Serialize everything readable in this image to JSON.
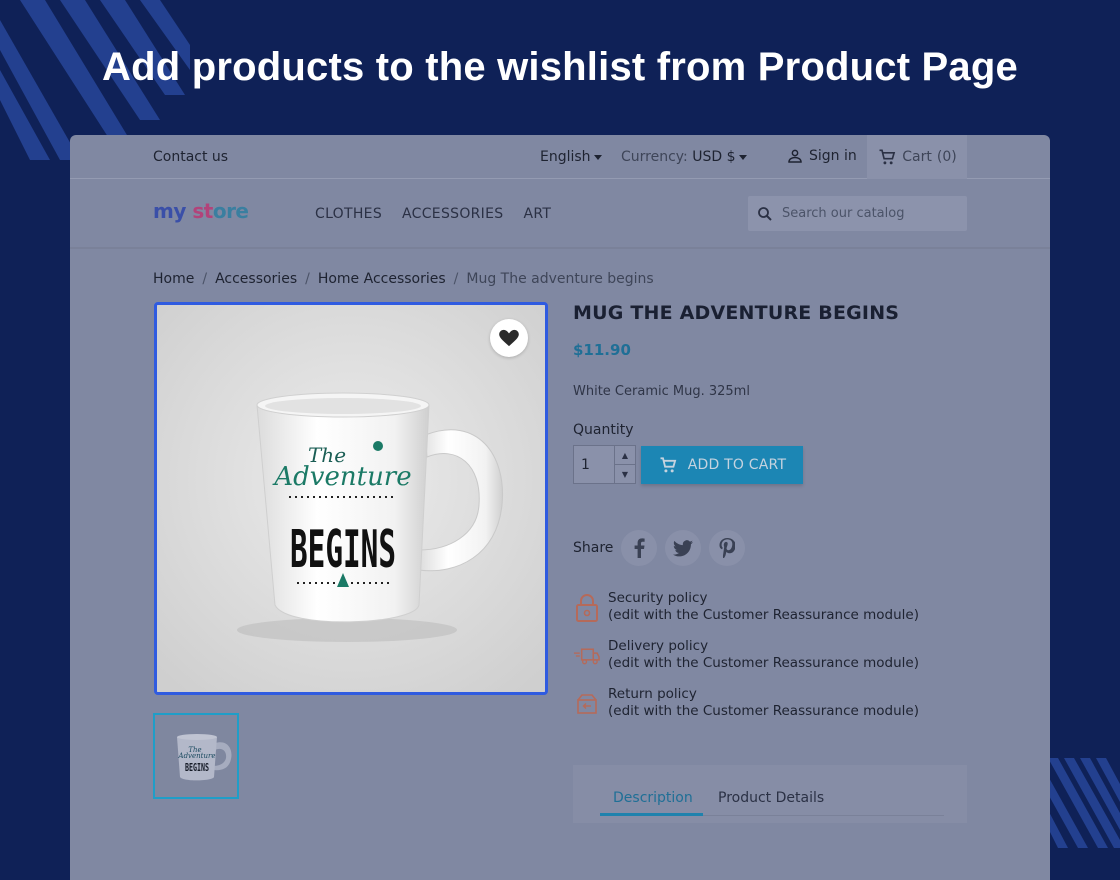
{
  "headline": "Add products to the wishlist from Product Page",
  "topbar": {
    "contact": "Contact us",
    "language": "English",
    "currency_label": "Currency:",
    "currency_value": "USD $",
    "signin": "Sign in",
    "cart": "Cart",
    "cart_count": "(0)"
  },
  "navbar": {
    "logo": {
      "part1": "my",
      "part2": " st",
      "part3": "ore"
    },
    "menu": [
      "CLOTHES",
      "ACCESSORIES",
      "ART"
    ],
    "search_placeholder": "Search our catalog"
  },
  "breadcrumb": [
    "Home",
    "Accessories",
    "Home Accessories",
    "Mug The adventure begins"
  ],
  "product": {
    "title": "MUG THE ADVENTURE BEGINS",
    "price": "$11.90",
    "description": "White Ceramic Mug. 325ml",
    "quantity_label": "Quantity",
    "quantity_value": "1",
    "add_to_cart": "ADD TO CART",
    "image_text": {
      "line1": "The",
      "line2": "Adventure",
      "line3": "BEGINS"
    }
  },
  "share": {
    "label": "Share",
    "networks": [
      "f",
      "t",
      "p"
    ]
  },
  "reassurance": [
    {
      "title": "Security policy",
      "note": "(edit with the Customer Reassurance module)",
      "icon": "lock-icon"
    },
    {
      "title": "Delivery policy",
      "note": "(edit with the Customer Reassurance module)",
      "icon": "truck-icon"
    },
    {
      "title": "Return policy",
      "note": "(edit with the Customer Reassurance module)",
      "icon": "return-box-icon"
    }
  ],
  "tabs": [
    "Description",
    "Product Details"
  ],
  "colors": {
    "background": "#0f2157",
    "accent": "#1c86b4",
    "highlight": "#2f5be0"
  }
}
